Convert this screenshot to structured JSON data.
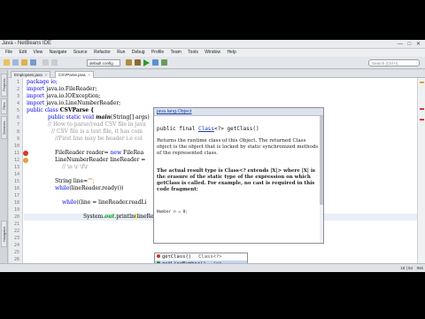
{
  "window": {
    "title": "Java - NetBeans IDE"
  },
  "menu": [
    "File",
    "Edit",
    "View",
    "Navigate",
    "Source",
    "Refactor",
    "Run",
    "Debug",
    "Profile",
    "Team",
    "Tools",
    "Window",
    "Help"
  ],
  "toolbar": {
    "config_value": "default config",
    "search_placeholder": "Search (Ctrl+I)"
  },
  "side_tabs": [
    "Projects",
    "Files",
    "Services",
    "Navigator"
  ],
  "tabs": [
    {
      "label": "Employees.java",
      "active": false
    },
    {
      "label": "CSVParse.java",
      "active": true
    }
  ],
  "code": {
    "line_numbers": [
      "1",
      "2",
      "3",
      "4",
      "5",
      "6",
      "7",
      "8",
      "9",
      "10",
      "11",
      "12",
      "13",
      "14",
      "15",
      "16",
      "17",
      "18",
      "19",
      "20",
      "21",
      "22",
      "23",
      "24",
      "25",
      "26"
    ],
    "l1": "package io;",
    "l2_kw": "import",
    "l2": " java.io.FileReader;",
    "l3_kw": "import",
    "l3": " java.io.IOException;",
    "l4_kw": "import",
    "l4": " java.io.LineNumberReader;",
    "l5_kw": "public class",
    "l5": " CSVParse {",
    "l6_kw": "public static void",
    "l6_name": " main",
    "l6": "(String[] args)",
    "l7": "// How to parse/read CSV file in java",
    "l8": "// CSV file is a text file, it has com",
    "l9": "//First line may be header i.e col",
    "l11": "FileReader reader= ",
    "l11_kw": "new",
    "l11_b": " FileRea",
    "l12": "LineNumberReader lineReader =",
    "l13": "// \\n  \\r  \\f\\r",
    "l15": "String line=",
    "l15_str": "\"\";",
    "l16_kw": "while",
    "l16": "(lineReader.ready())",
    "l18_kw": "while",
    "l18": "((line = lineReader.readLi",
    "l20_a": "System.",
    "l20_out": "out",
    "l20_b": ".println(lineReader.getLine());"
  },
  "javadoc": {
    "header": "java.lang.Object",
    "signature_pre": "public final ",
    "signature_link": "Class",
    "signature_post": "<?> getClass()",
    "p1": "Returns the runtime class of this Object. The returned Class object is the object that is locked by static synchronized methods of the represented class.",
    "p2": "The actual result type is Class<? extends |X|> where |X| is the erasure of the static type of the expression on which getClass is called. For example, no cast is required in this code fragment:",
    "p3": "Number n = 0;"
  },
  "completion": {
    "items": [
      {
        "label": "getClass()",
        "type": "Class<?>",
        "selected": false,
        "icon_color": "#c23a2b"
      },
      {
        "label": "getLineNumber()",
        "type": "int",
        "selected": true,
        "icon_color": "#3a7a2b"
      }
    ]
  },
  "status": {
    "position": "18 | 54",
    "mode": "INS"
  }
}
